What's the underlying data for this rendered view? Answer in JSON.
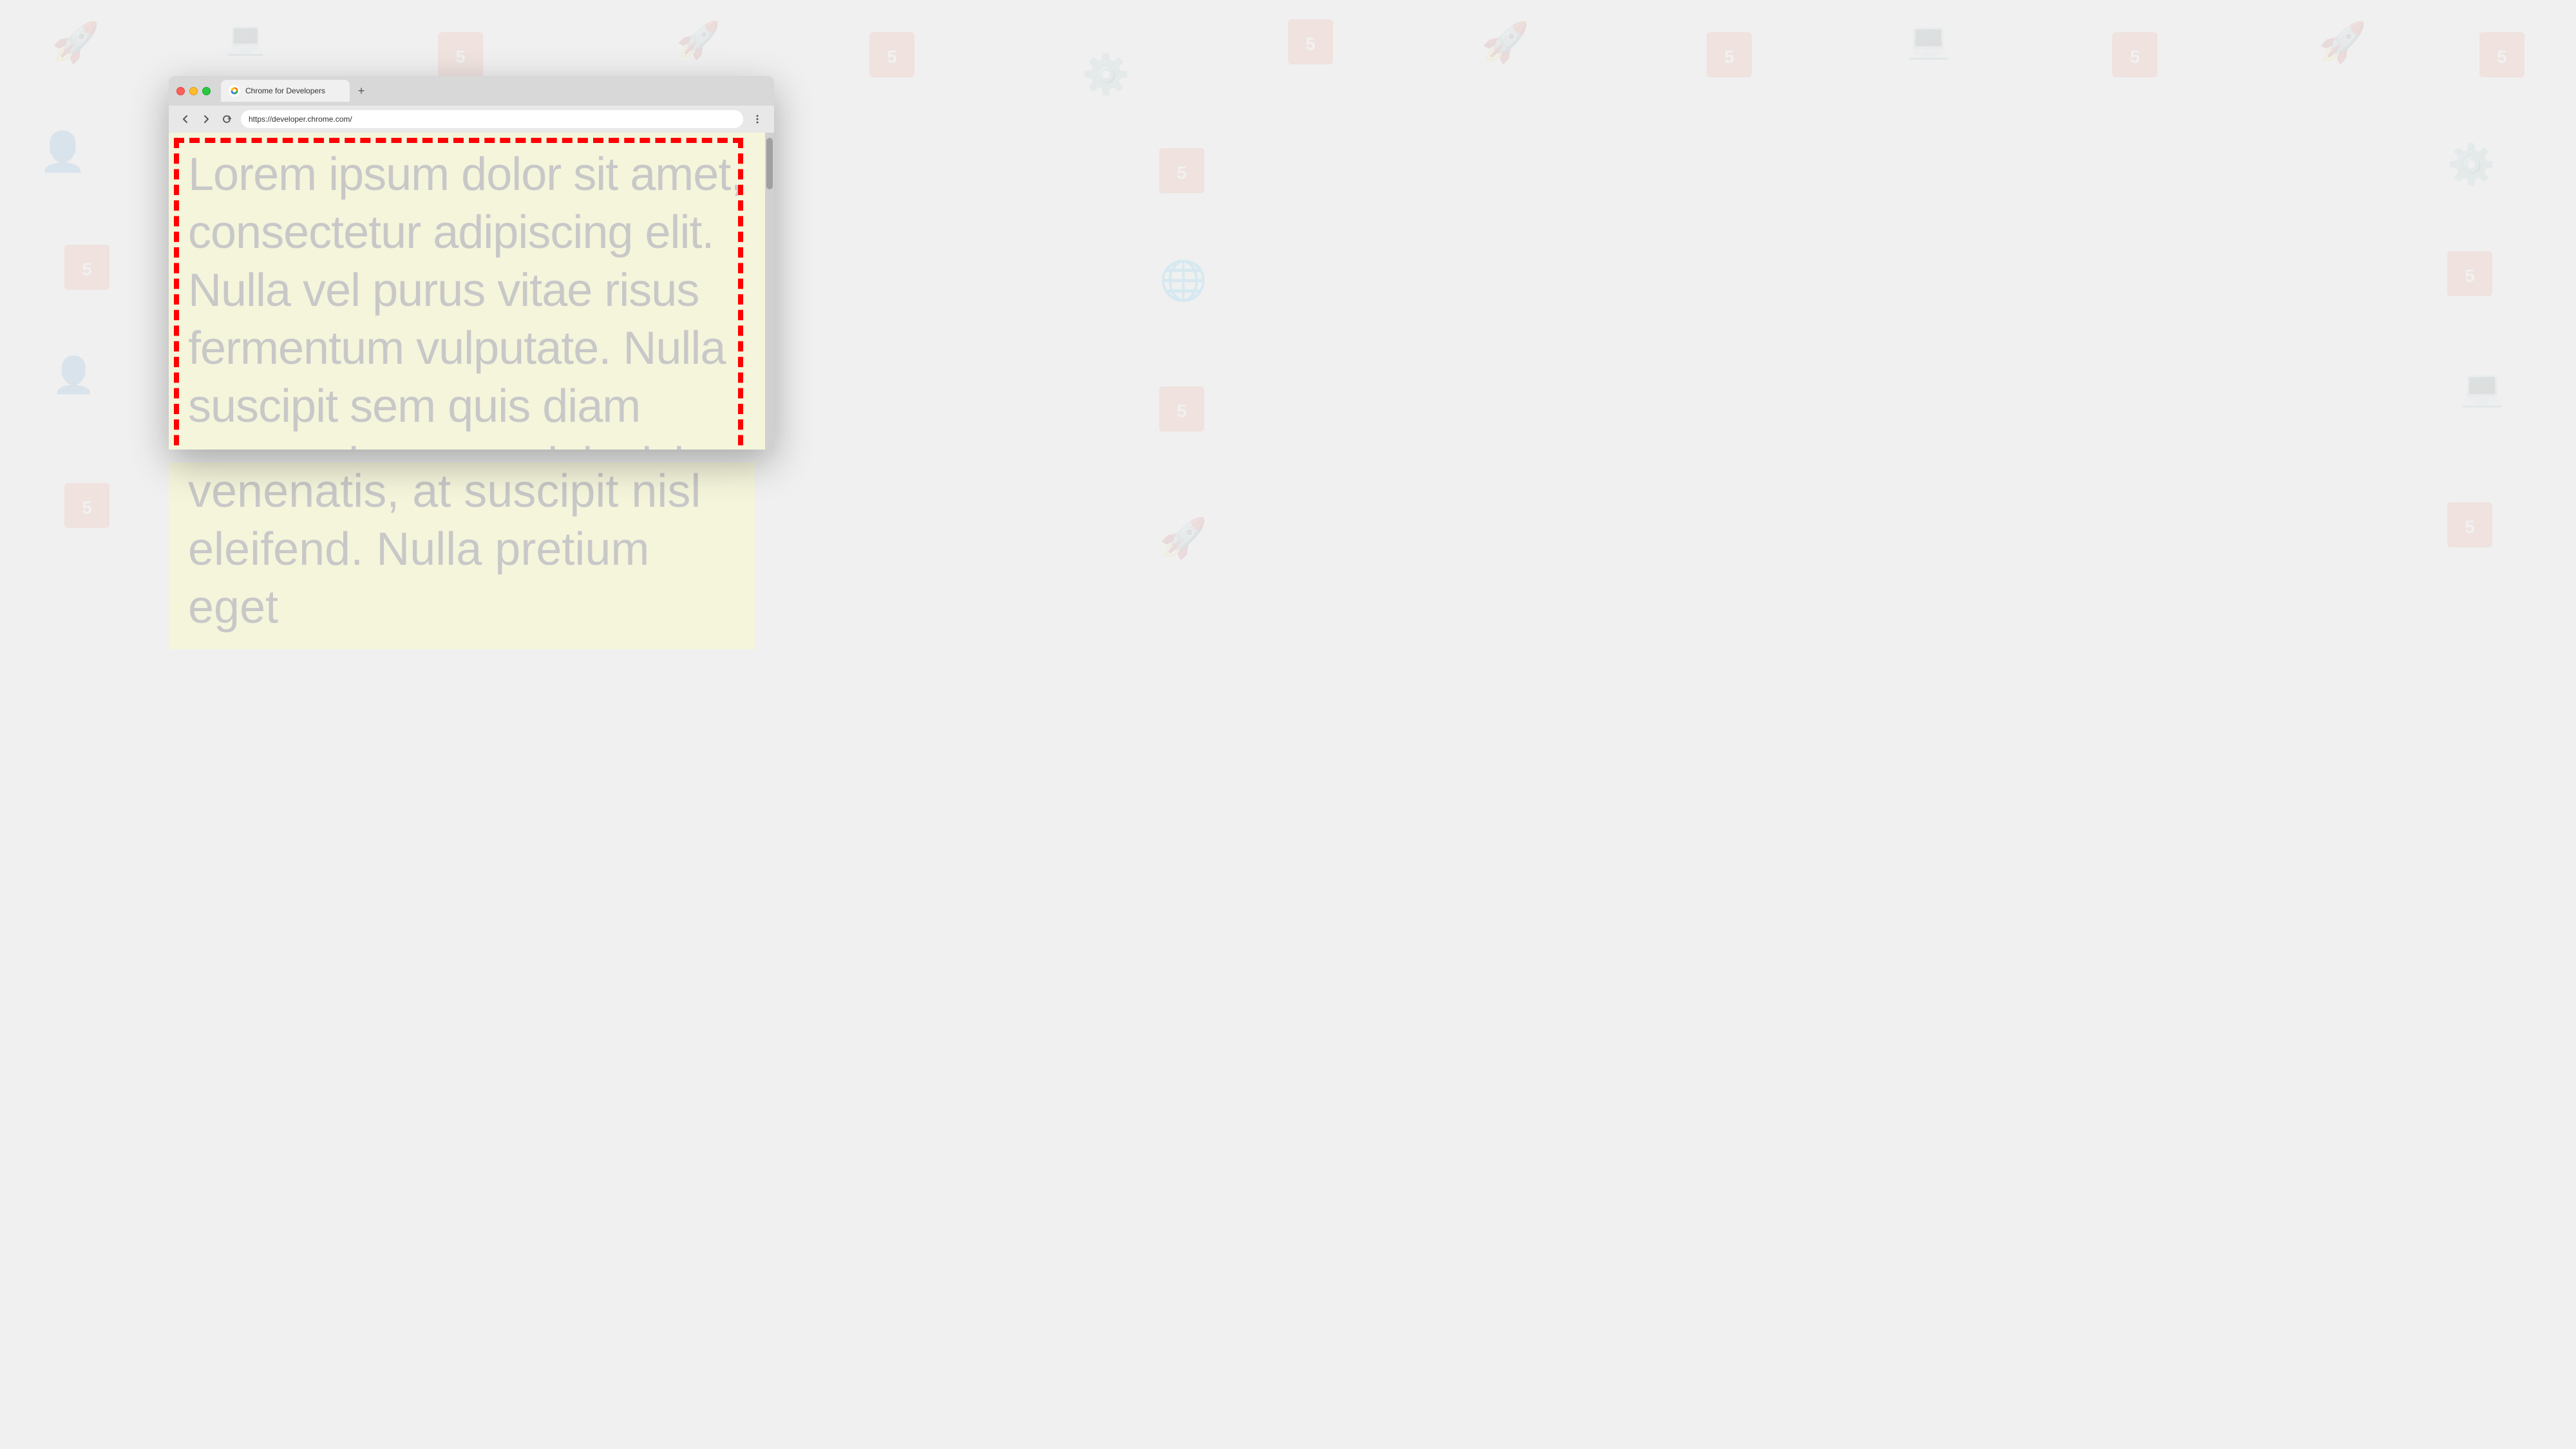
{
  "browser": {
    "tab": {
      "title": "Chrome for Developers",
      "favicon": "chrome"
    },
    "new_tab_label": "+",
    "address": "https://developer.chrome.com/",
    "nav": {
      "back_label": "←",
      "forward_label": "→",
      "reload_label": "↻"
    },
    "menu_label": "⋮"
  },
  "content": {
    "lorem_text": "Lorem ipsum dolor sit amet, consectetur adipiscing elit. Nulla vel purus vitae risus fermentum vulputate. Nulla suscipit sem quis diam venenatis, at suscipit nisl eleifend. Nulla pretium eget",
    "below_text": "venenatis, at suscipit nisl eleifend. Nulla pretium eget"
  },
  "colors": {
    "accent_red": "#ff0000",
    "tab_bg": "#f0f0f0",
    "titlebar_bg": "#d8d8d8",
    "content_bg": "#f5f5dc",
    "text_color": "#c8c8c8"
  },
  "icons": {
    "back": "back-arrow",
    "forward": "forward-arrow",
    "reload": "reload-arrow",
    "menu": "three-dots-menu",
    "new_tab": "plus"
  }
}
